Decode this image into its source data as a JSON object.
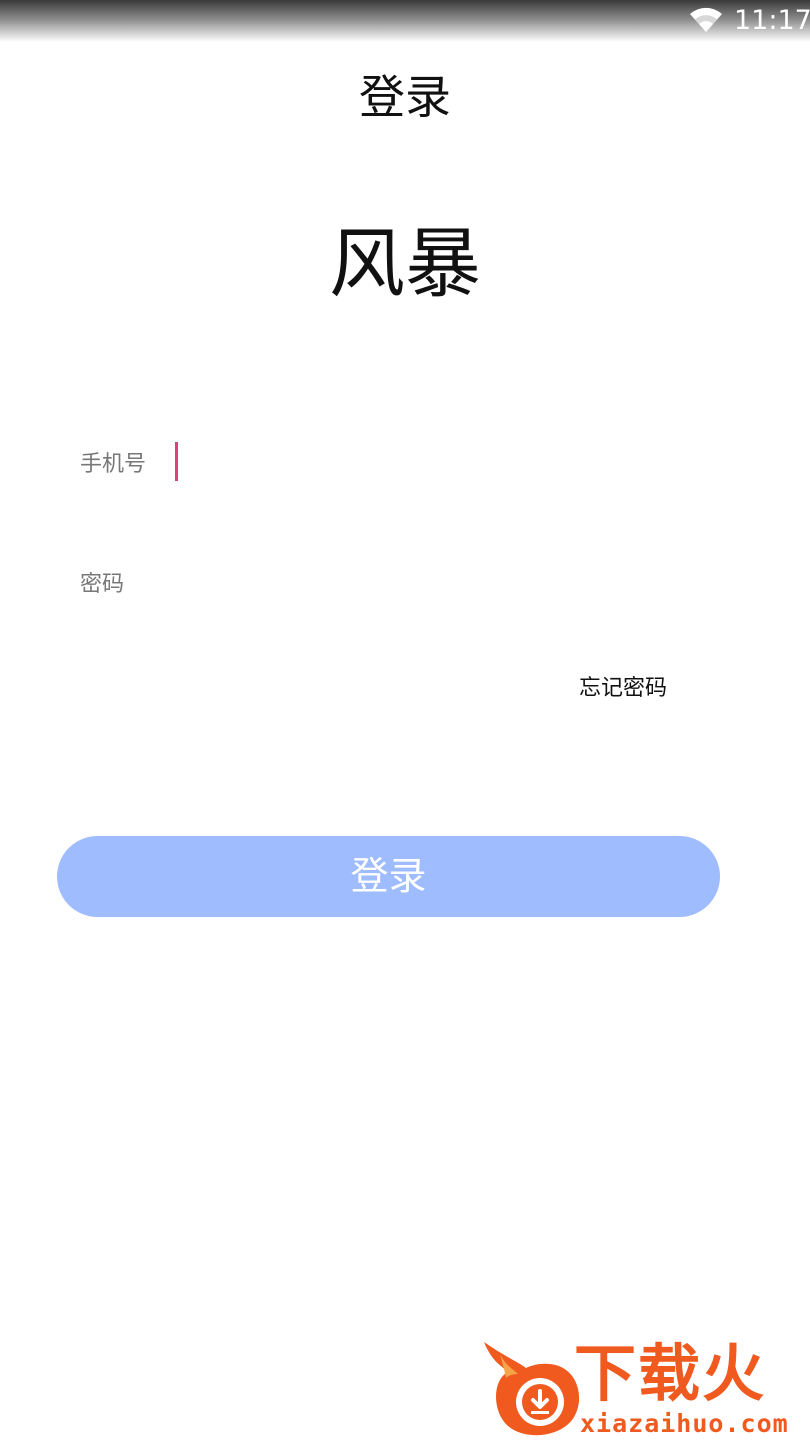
{
  "status_bar": {
    "time": "11:17",
    "wifi_icon": "wifi-icon"
  },
  "header": {
    "title": "登录"
  },
  "brand": {
    "name": "风暴"
  },
  "form": {
    "phone_label": "手机号",
    "phone_value": "",
    "password_label": "密码",
    "password_value": "",
    "forgot_password": "忘记密码",
    "submit_label": "登录",
    "submit_color": "#9fbcff",
    "cursor_color": "#e0407a"
  },
  "watermark": {
    "text": "下载火",
    "url": "xiazaihuo.com",
    "color": "#f05a1e"
  }
}
